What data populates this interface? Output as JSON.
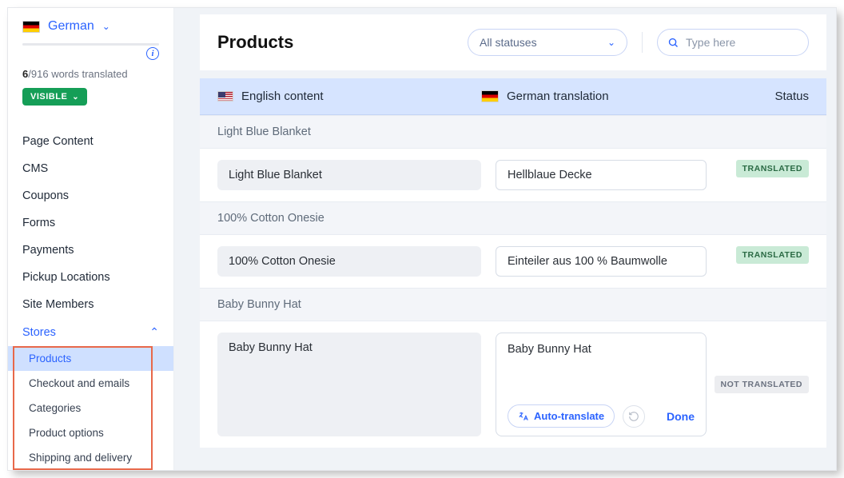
{
  "sidebar": {
    "language_name": "German",
    "words_current": "6",
    "words_total": "916",
    "words_suffix": "words translated",
    "visible_label": "VISIBLE",
    "nav": [
      {
        "label": "Page Content"
      },
      {
        "label": "CMS"
      },
      {
        "label": "Coupons"
      },
      {
        "label": "Forms"
      },
      {
        "label": "Payments"
      },
      {
        "label": "Pickup Locations"
      },
      {
        "label": "Site Members"
      }
    ],
    "section_label": "Stores",
    "sub_items": [
      {
        "label": "Products",
        "active": true
      },
      {
        "label": "Checkout and emails"
      },
      {
        "label": "Categories"
      },
      {
        "label": "Product options"
      },
      {
        "label": "Shipping and delivery"
      }
    ]
  },
  "main": {
    "title": "Products",
    "status_filter": "All statuses",
    "search_placeholder": "Type here",
    "columns": {
      "source": "English content",
      "target": "German translation",
      "status": "Status"
    },
    "groups": [
      {
        "name": "Light Blue Blanket",
        "rows": [
          {
            "src": "Light Blue Blanket",
            "trg": "Hellblaue Decke",
            "status": "TRANSLATED"
          }
        ]
      },
      {
        "name": "100% Cotton Onesie",
        "rows": [
          {
            "src": "100% Cotton Onesie",
            "trg": "Einteiler aus 100 % Baumwolle",
            "status": "TRANSLATED"
          }
        ]
      },
      {
        "name": "Baby Bunny Hat",
        "rows": [
          {
            "src": "Baby Bunny Hat",
            "trg": "Baby Bunny Hat",
            "status": "NOT TRANSLATED",
            "expanded": true
          }
        ]
      }
    ],
    "auto_translate_label": "Auto-translate",
    "done_label": "Done"
  }
}
